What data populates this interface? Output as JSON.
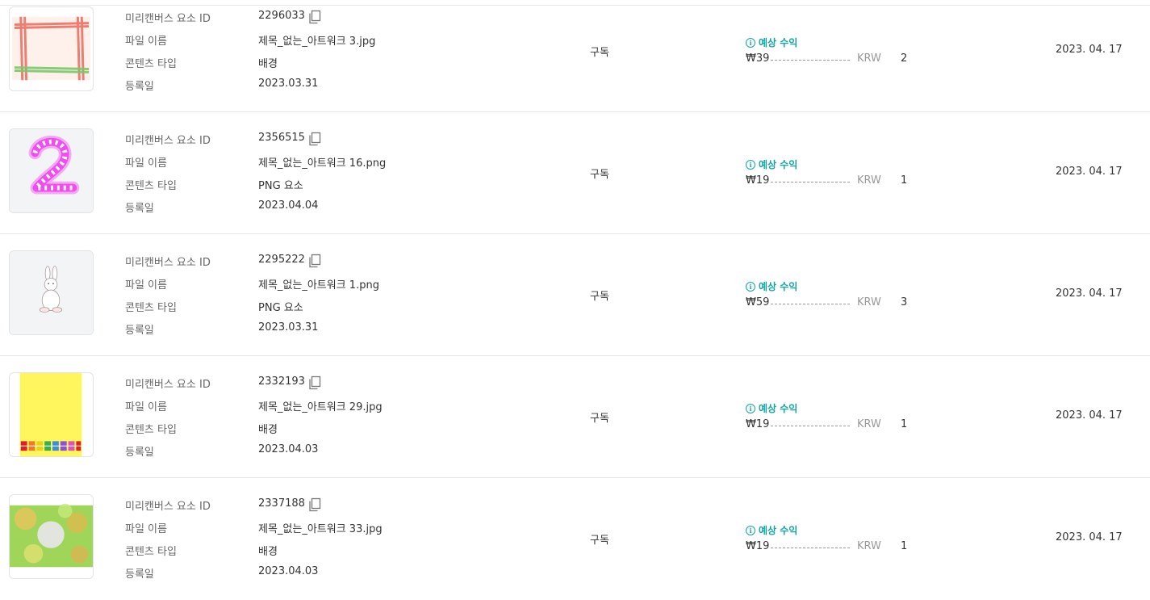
{
  "labels": {
    "element_id": "미리캔버스 요소 ID",
    "file_name": "파일 이름",
    "content_type": "콘텐츠 타입",
    "registered": "등록일"
  },
  "estimated_label": "예상 수익",
  "currency": "KRW",
  "rows": [
    {
      "thumb": "frame-image",
      "element_id": "2296033",
      "file_name": "제목_없는_아트워크 3.jpg",
      "content_type": "배경",
      "registered": "2023.03.31",
      "type": "구독",
      "amount": "₩39",
      "count": "2",
      "date": "2023. 04. 17"
    },
    {
      "thumb": "number-two-image",
      "element_id": "2356515",
      "file_name": "제목_없는_아트워크 16.png",
      "content_type": "PNG 요소",
      "registered": "2023.04.04",
      "type": "구독",
      "amount": "₩19",
      "count": "1",
      "date": "2023. 04. 17"
    },
    {
      "thumb": "rabbit-image",
      "element_id": "2295222",
      "file_name": "제목_없는_아트워크 1.png",
      "content_type": "PNG 요소",
      "registered": "2023.03.31",
      "type": "구독",
      "amount": "₩59",
      "count": "3",
      "date": "2023. 04. 17"
    },
    {
      "thumb": "yellow-gift-image",
      "element_id": "2332193",
      "file_name": "제목_없는_아트워크 29.jpg",
      "content_type": "배경",
      "registered": "2023.04.03",
      "type": "구독",
      "amount": "₩19",
      "count": "1",
      "date": "2023. 04. 17"
    },
    {
      "thumb": "green-bokeh-image",
      "element_id": "2337188",
      "file_name": "제목_없는_아트워크 33.jpg",
      "content_type": "배경",
      "registered": "2023.04.03",
      "type": "구독",
      "amount": "₩19",
      "count": "1",
      "date": "2023. 04. 17"
    }
  ]
}
